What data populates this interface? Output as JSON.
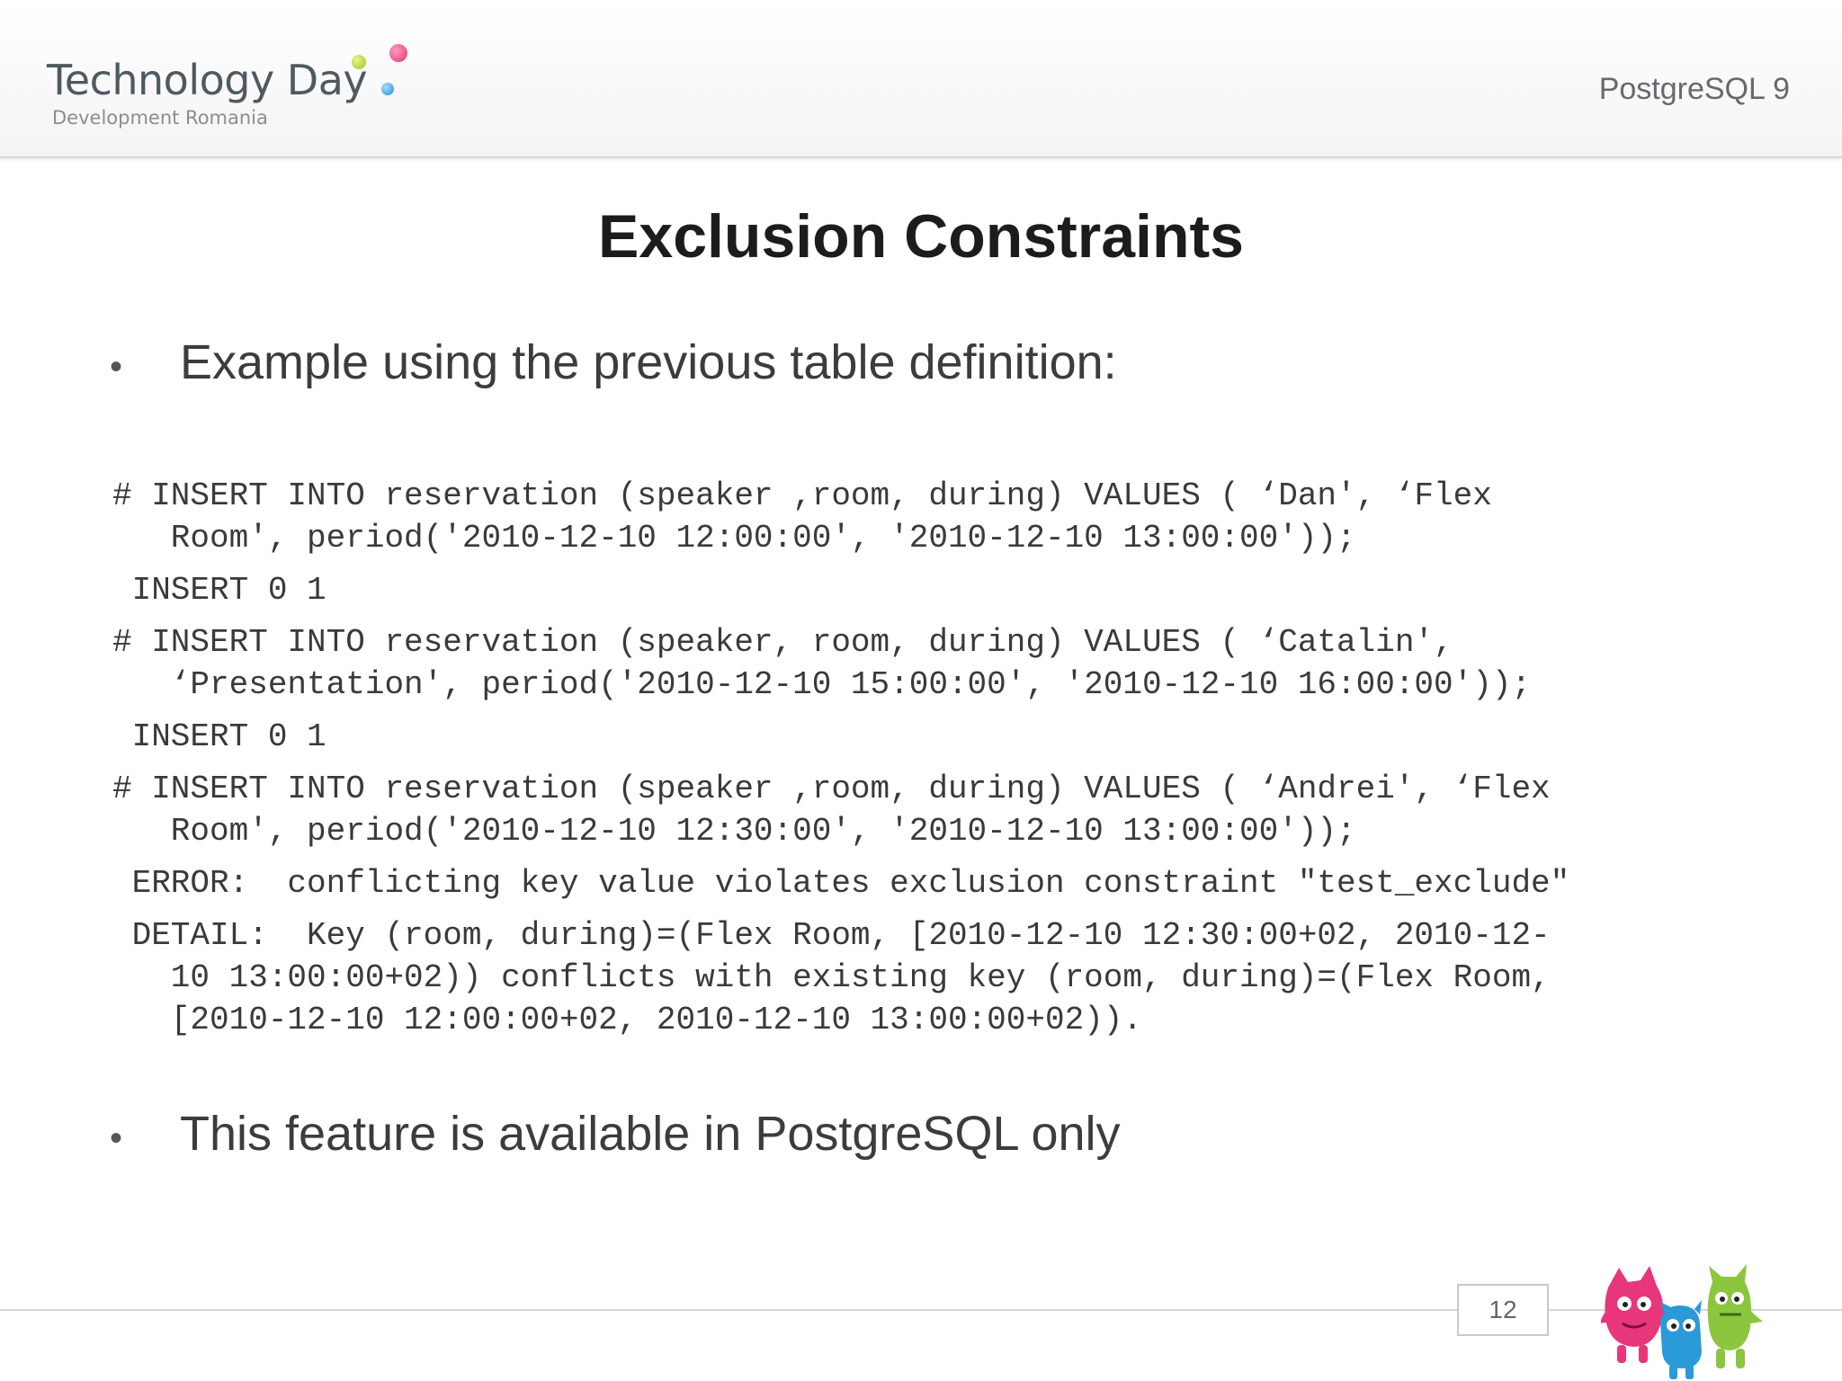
{
  "header": {
    "logo_title": "Technology Day",
    "logo_subtitle": "Development Romania",
    "right_text": "PostgreSQL 9"
  },
  "slide": {
    "title": "Exclusion Constraints",
    "bullets": [
      "Example using the previous table definition:",
      "This feature is available in PostgreSQL only"
    ],
    "code_lines": [
      "# INSERT INTO reservation (speaker ,room, during) VALUES ( ‘Dan', ‘Flex",
      "   Room', period('2010-12-10 12:00:00', '2010-12-10 13:00:00'));",
      " INSERT 0 1",
      "# INSERT INTO reservation (speaker, room, during) VALUES ( ‘Catalin',",
      "   ‘Presentation', period('2010-12-10 15:00:00', '2010-12-10 16:00:00'));",
      " INSERT 0 1",
      "# INSERT INTO reservation (speaker ,room, during) VALUES ( ‘Andrei', ‘Flex",
      "   Room', period('2010-12-10 12:30:00', '2010-12-10 13:00:00'));",
      " ERROR:  conflicting key value violates exclusion constraint \"test_exclude\"",
      " DETAIL:  Key (room, during)=(Flex Room, [2010-12-10 12:30:00+02, 2010-12-",
      "   10 13:00:00+02)) conflicts with existing key (room, during)=(Flex Room,",
      "   [2010-12-10 12:00:00+02, 2010-12-10 13:00:00+02))."
    ],
    "page_number": "12"
  },
  "colors": {
    "dot_green": "#9bc41f",
    "dot_pink": "#e3306e",
    "dot_blue": "#1f8fd6",
    "mascot_pink": "#e8367a",
    "mascot_blue": "#2a9ad8",
    "mascot_green": "#8cc63f"
  }
}
